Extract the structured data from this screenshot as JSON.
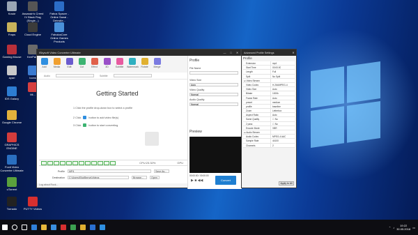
{
  "desktop": {
    "icons": [
      {
        "label": "Kosár",
        "color": "#9aa6b5"
      },
      {
        "label": "Assassin's Creed IV Black Flag (Single...)",
        "color": "#555555"
      },
      {
        "label": "Fabus Spacer - Online Sanai - Deinstle...",
        "color": "#2b6dc7"
      },
      {
        "label": "Fraps",
        "color": "#c8b25a"
      },
      {
        "label": "Cloud Engine",
        "color": "#3b3b3b"
      },
      {
        "label": "FabulusCore Online Games Products",
        "color": "#4a90d9"
      },
      {
        "label": "Gaming Mouse",
        "color": "#b8303a"
      },
      {
        "label": "ayari",
        "color": "#c9c9c9"
      },
      {
        "label": "IDS Galaxy",
        "color": "#2d7dd2"
      },
      {
        "label": "Google Chrome",
        "color": "#e3b23c"
      },
      {
        "label": "GRAPHICS ENGINE",
        "color": "#d33c3c"
      },
      {
        "label": "KeePass",
        "color": "#6a6a6a"
      },
      {
        "label": "Icons",
        "color": "#3a7ad0"
      },
      {
        "label": "Foxit Video Converter Ultimate",
        "color": "#2a6fc0"
      },
      {
        "label": "uTorrent",
        "color": "#5aa03c"
      },
      {
        "label": "Tornado",
        "color": "#222222"
      },
      {
        "label": "PUTTY Videos",
        "color": "#d62f2f"
      },
      {
        "label": "Mi...",
        "color": "#d64040"
      }
    ]
  },
  "main_window": {
    "title": "iSkysoft Video Converter Ultimate",
    "controls": [
      "—",
      "□",
      "✕"
    ],
    "toolbar": [
      {
        "label": "Add",
        "color": "#2f8fe0"
      },
      {
        "label": "Media",
        "color": "#f0a030"
      },
      {
        "label": "Edit",
        "color": "#6a5acd"
      },
      {
        "label": "Cut",
        "color": "#3cb371"
      },
      {
        "label": "Effect",
        "color": "#e0604a"
      },
      {
        "label": "3D",
        "color": "#9a50c8"
      },
      {
        "label": "Subtitle",
        "color": "#e85aa0"
      },
      {
        "label": "Watermark",
        "color": "#2fb0c0"
      },
      {
        "label": "Rotate",
        "color": "#e0b030"
      },
      {
        "label": "Merge",
        "color": "#7a7ae0"
      }
    ],
    "subbar": {
      "audio_label": "Audio",
      "subtitle_label": "Subtitle"
    },
    "getting_started": {
      "title": "Getting Started",
      "step1": "1  Click the profile drop-down box to select a profile",
      "step2_prefix": "2  Click",
      "step2_suffix": "button to add video file(s)",
      "step3_prefix": "3  Click",
      "step3_suffix": "button to start converting"
    },
    "side": {
      "profile_heading": "Profile",
      "file_name_label": "File Name",
      "video_size_label": "Video Size",
      "video_size_value": "Auto",
      "video_quality_label": "Video Quality",
      "video_quality_value": "Normal",
      "audio_quality_label": "Audio Quality",
      "audio_quality_value": "Normal",
      "preview_heading": "Preview",
      "preview_time": "00:00:00 / 00:00:00"
    },
    "cpu_label": "CPU:23.32%",
    "gpu_label": "GPU",
    "profile_row": {
      "label": "Profile",
      "value": "MP4",
      "save_as": "Save As..."
    },
    "destination_row": {
      "label": "Destination",
      "value": "C:\\Users\\Elia\\Berna\\Videos",
      "browse": "Browse...",
      "open": "Open"
    },
    "convert_label": "Convert",
    "status_text": "Log about Rock..."
  },
  "advanced_window": {
    "title": "Advanced Profile Settings",
    "heading": "Profile",
    "rows": [
      {
        "key": "Extension",
        "value": "mp4",
        "section": false
      },
      {
        "key": "Start Time",
        "value": "00:00:00",
        "section": false
      },
      {
        "key": "Length",
        "value": "Full",
        "section": false
      },
      {
        "key": "Split",
        "value": "No Split",
        "section": false
      },
      {
        "key": "⊟ Video Stream",
        "value": "",
        "section": true
      },
      {
        "key": "Video Codec",
        "value": "H.264/MPEG-4",
        "section": false
      },
      {
        "key": "Video Size",
        "value": "Auto",
        "section": false
      },
      {
        "key": "Bitrate",
        "value": "1000k",
        "section": false
      },
      {
        "key": "Frame Rate",
        "value": "Auto",
        "section": false
      },
      {
        "key": "preset",
        "value": "medium",
        "section": false
      },
      {
        "key": "profile",
        "value": "baseline",
        "section": false
      },
      {
        "key": "Zoom",
        "value": "Letterbox",
        "section": false
      },
      {
        "key": "Aspect Ratio",
        "value": "Auto",
        "section": false
      },
      {
        "key": "Same Quality",
        "value": "☐ No",
        "section": false
      },
      {
        "key": "2 pass",
        "value": "☐ No",
        "section": false
      },
      {
        "key": "Encode Mode",
        "value": "VBR",
        "section": false
      },
      {
        "key": "⊟ Audio Stream",
        "value": "",
        "section": true
      },
      {
        "key": "Audio Codec",
        "value": "MPEG-4 AAC",
        "section": false
      },
      {
        "key": "Sample Rate",
        "value": "44100",
        "section": false
      },
      {
        "key": "Channels",
        "value": "2",
        "section": false
      }
    ],
    "apply_label": "Apply to All"
  },
  "taskbar": {
    "icons": [
      {
        "name": "windows-start-icon",
        "color": "#ffffff"
      },
      {
        "name": "search-icon",
        "color": "#ffffff"
      },
      {
        "name": "task-view-icon",
        "color": "#ffffff"
      },
      {
        "name": "edge-icon",
        "color": "#2f7fd8"
      },
      {
        "name": "file-explorer-icon",
        "color": "#e8b83c"
      },
      {
        "name": "store-icon",
        "color": "#3a8fe0"
      },
      {
        "name": "app-red-icon",
        "color": "#d83030"
      },
      {
        "name": "app-green-icon",
        "color": "#3ca050"
      },
      {
        "name": "chrome-icon",
        "color": "#e0b030"
      },
      {
        "name": "app-blue-icon",
        "color": "#2a6fd0"
      },
      {
        "name": "video-converter-icon",
        "color": "#2f8fe0"
      }
    ],
    "clock_time": "19:22",
    "clock_date": "30.05.2018"
  },
  "colors": {
    "accent": "#1f7fd1",
    "taskbar": "#0d0d12",
    "titlebar": "#2b2b2b"
  }
}
